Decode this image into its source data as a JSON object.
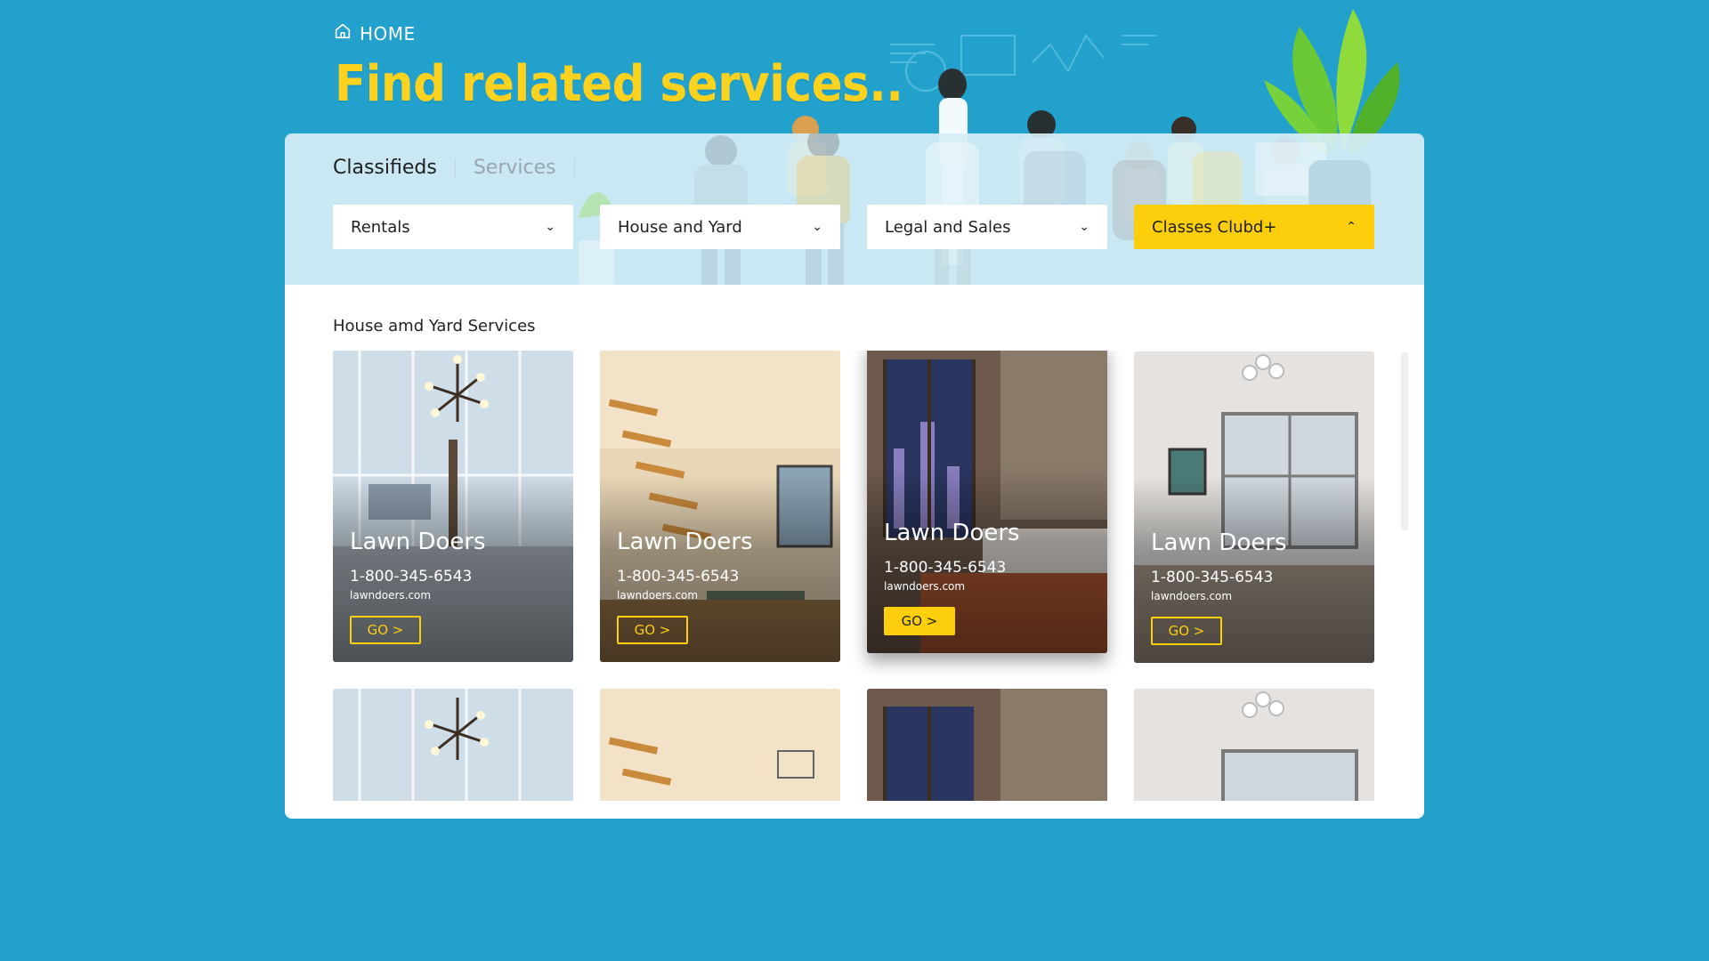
{
  "breadcrumb": {
    "home_label": "HOME"
  },
  "hero": {
    "title": "Find related services.."
  },
  "tabs": [
    {
      "label": "Classifieds"
    },
    {
      "label": "Services"
    }
  ],
  "filters": [
    {
      "label": "Rentals",
      "chevron": "⌄"
    },
    {
      "label": "House and Yard",
      "chevron": "⌄"
    },
    {
      "label": "Legal and Sales",
      "chevron": "⌄"
    },
    {
      "label": "Classes Clubd+",
      "chevron": "⌃"
    }
  ],
  "results": {
    "section_title": "House amd Yard Services",
    "cards": [
      {
        "name": "Lawn Doers",
        "phone": "1-800-345-6543",
        "site": "lawndoers.com",
        "cta": "GO >"
      },
      {
        "name": "Lawn Doers",
        "phone": "1-800-345-6543",
        "site": "lawndoers.com",
        "cta": "GO >"
      },
      {
        "name": "Lawn Doers",
        "phone": "1-800-345-6543",
        "site": "lawndoers.com",
        "cta": "GO >"
      },
      {
        "name": "Lawn Doers",
        "phone": "1-800-345-6543",
        "site": "lawndoers.com",
        "cta": "GO >"
      }
    ]
  },
  "colors": {
    "background": "#21a1cc",
    "accent_yellow": "#fcce0c",
    "title_yellow": "#fcd21f",
    "panel_light_blue": "#d6eef6"
  },
  "icons": {
    "home": "home-icon",
    "chevron_down": "chevron-down-icon",
    "chevron_up": "chevron-up-icon"
  }
}
